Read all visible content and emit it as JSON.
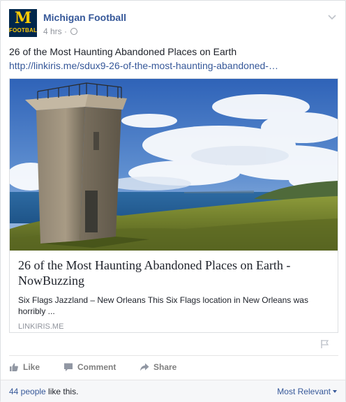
{
  "post": {
    "page_name": "Michigan Football",
    "timestamp": "4 hrs",
    "separator": "·",
    "avatar": {
      "letter": "M",
      "label": "FOOTBALL"
    },
    "caption": "26 of the Most Haunting Abandoned Places on Earth",
    "link_url": "http://linkiris.me/sdux9-26-of-the-most-haunting-abandoned-…"
  },
  "attachment": {
    "title": "26 of the Most Haunting Abandoned Places on Earth - NowBuzzing",
    "description": "Six Flags Jazzland – New Orleans This Six Flags location in New Orleans was horribly ...",
    "domain": "LINKIRIS.ME"
  },
  "actions": {
    "like_label": "Like",
    "comment_label": "Comment",
    "share_label": "Share"
  },
  "footer": {
    "likes_count": "44 people",
    "likes_suffix": " like this.",
    "sort_label": "Most Relevant"
  },
  "colors": {
    "link": "#365899",
    "muted": "#90949c",
    "avatar_bg": "#00274c",
    "maize": "#ffcb05"
  }
}
